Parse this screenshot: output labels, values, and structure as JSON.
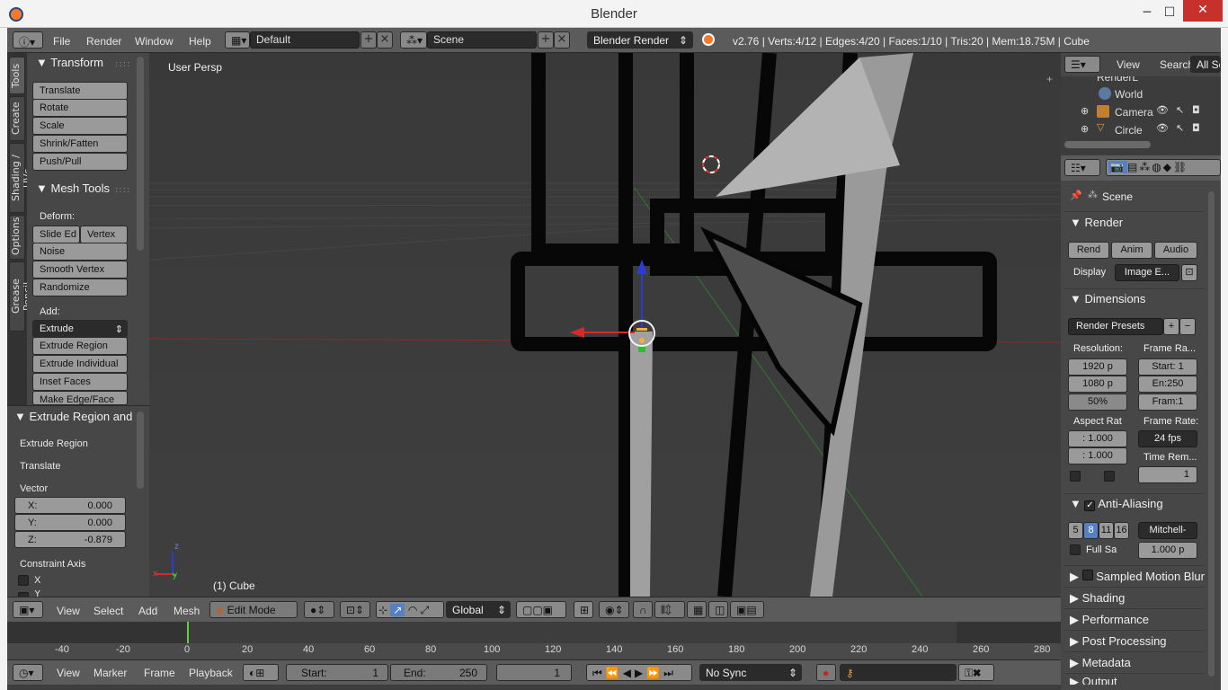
{
  "window": {
    "title": "Blender",
    "minimize": "─",
    "maximize": "☐",
    "close": "✕"
  },
  "info_header": {
    "menus": [
      "File",
      "Render",
      "Window",
      "Help"
    ],
    "layout": "Default",
    "scene": "Scene",
    "engine": "Blender Render",
    "stats": "v2.76 | Verts:4/12 | Edges:4/20 | Faces:1/10 | Tris:20 | Mem:18.75M | Cube"
  },
  "tabs": [
    "Tools",
    "Create",
    "Shading / UVs",
    "Options",
    "Grease Pencil"
  ],
  "toolshelf": {
    "transform": {
      "title": "Transform",
      "buttons": [
        "Translate",
        "Rotate",
        "Scale",
        "Shrink/Fatten",
        "Push/Pull"
      ]
    },
    "mesh_tools": {
      "title": "Mesh Tools",
      "deform_label": "Deform:",
      "slide_edge": "Slide Ed",
      "vertex": "Vertex",
      "deform_buttons": [
        "Noise",
        "Smooth Vertex",
        "Randomize"
      ],
      "add_label": "Add:",
      "extrude": "Extrude",
      "add_buttons": [
        "Extrude Region",
        "Extrude Individual",
        "Inset Faces",
        "Make Edge/Face"
      ]
    }
  },
  "redo_panel": {
    "title": "Extrude Region and",
    "lines": [
      "Extrude Region",
      "Translate"
    ],
    "vector_label": "Vector",
    "vector": [
      {
        "axis": "X:",
        "value": "0.000"
      },
      {
        "axis": "Y:",
        "value": "0.000"
      },
      {
        "axis": "Z:",
        "value": "-0.879"
      }
    ],
    "constraint_label": "Constraint Axis",
    "constraint_x": "X",
    "constraint_y": "Y"
  },
  "viewport": {
    "view_name": "User Persp",
    "object_label": "(1) Cube",
    "axis_z": "z",
    "axis_y": "y",
    "axis_x": "x"
  },
  "view_header": {
    "menus": [
      "View",
      "Select",
      "Add",
      "Mesh"
    ],
    "mode": "Edit Mode",
    "orientation": "Global"
  },
  "timeline": {
    "ticks": [
      "-40",
      "-20",
      "0",
      "20",
      "40",
      "60",
      "80",
      "100",
      "120",
      "140",
      "160",
      "180",
      "200",
      "220",
      "240",
      "260",
      "280"
    ],
    "current_frame": 0,
    "menus": [
      "View",
      "Marker",
      "Frame",
      "Playback"
    ],
    "start_label": "Start:",
    "start": "1",
    "end_label": "End:",
    "end": "250",
    "frame": "1",
    "sync": "No Sync"
  },
  "outliner": {
    "menus": [
      "View",
      "Search"
    ],
    "filter": "All Sc",
    "items": [
      "RenderL",
      "World",
      "Camera",
      "Circle"
    ]
  },
  "properties": {
    "scene": "Scene",
    "render": {
      "title": "Render",
      "render_btn": "Rend",
      "anim_btn": "Anim",
      "audio_btn": "Audio",
      "display_label": "Display",
      "display": "Image E..."
    },
    "dimensions": {
      "title": "Dimensions",
      "presets": "Render Presets",
      "resolution_label": "Resolution:",
      "res_x": "1920 p",
      "res_y": "1080 p",
      "res_pct": "50%",
      "frame_range_label": "Frame Ra...",
      "start": "Start: 1",
      "end": "En:250",
      "step": "Fram:1",
      "aspect_label": "Aspect Rat",
      "aspect_x": ": 1.000",
      "aspect_y": ": 1.000",
      "frame_rate_label": "Frame Rate:",
      "fps": "24 fps",
      "time_remap_label": "Time Rem...",
      "time_remap": "1"
    },
    "anti_aliasing": {
      "title": "Anti-Aliasing",
      "samples": [
        "5",
        "8",
        "11",
        "16"
      ],
      "selected": "8",
      "filter": "Mitchell-",
      "full_sample": "Full Sa",
      "size": "1.000 p"
    },
    "collapsed_panels": [
      "Sampled Motion Blur",
      "Shading",
      "Performance",
      "Post Processing",
      "Metadata",
      "Output"
    ]
  },
  "colors": {
    "accent": "#5680c2",
    "header": "#5b5b5b",
    "panel": "#474747",
    "viewport": "#3d3d3d"
  }
}
